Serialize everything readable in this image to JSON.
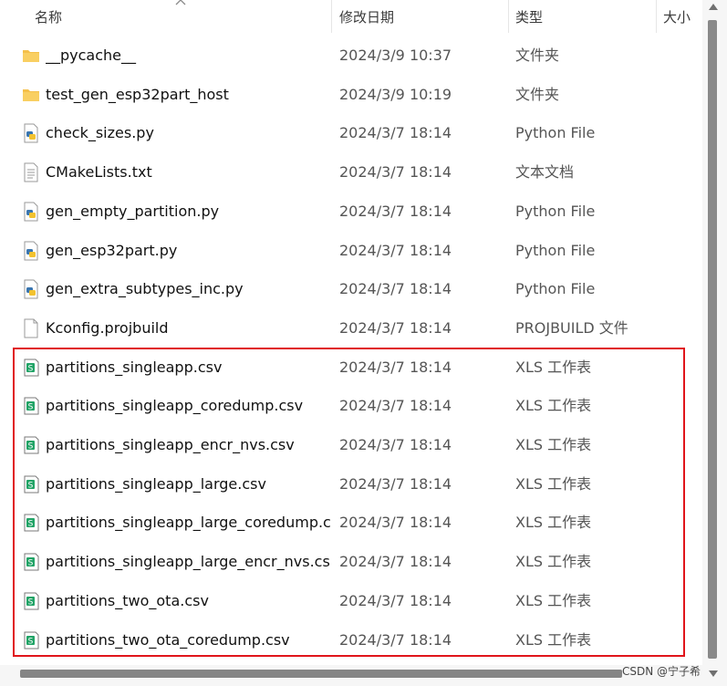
{
  "columns": {
    "name": "名称",
    "modified": "修改日期",
    "type": "类型",
    "size": "大小"
  },
  "files": [
    {
      "icon": "folder-icon",
      "name": "__pycache__",
      "modified": "2024/3/9 10:37",
      "type": "文件夹"
    },
    {
      "icon": "folder-icon",
      "name": "test_gen_esp32part_host",
      "modified": "2024/3/9 10:19",
      "type": "文件夹"
    },
    {
      "icon": "python-file-icon",
      "name": "check_sizes.py",
      "modified": "2024/3/7 18:14",
      "type": "Python File"
    },
    {
      "icon": "text-file-icon",
      "name": "CMakeLists.txt",
      "modified": "2024/3/7 18:14",
      "type": "文本文档"
    },
    {
      "icon": "python-file-icon",
      "name": "gen_empty_partition.py",
      "modified": "2024/3/7 18:14",
      "type": "Python File"
    },
    {
      "icon": "python-file-icon",
      "name": "gen_esp32part.py",
      "modified": "2024/3/7 18:14",
      "type": "Python File"
    },
    {
      "icon": "python-file-icon",
      "name": "gen_extra_subtypes_inc.py",
      "modified": "2024/3/7 18:14",
      "type": "Python File"
    },
    {
      "icon": "blank-file-icon",
      "name": "Kconfig.projbuild",
      "modified": "2024/3/7 18:14",
      "type": "PROJBUILD 文件"
    },
    {
      "icon": "spreadsheet-file-icon",
      "name": "partitions_singleapp.csv",
      "modified": "2024/3/7 18:14",
      "type": "XLS 工作表"
    },
    {
      "icon": "spreadsheet-file-icon",
      "name": "partitions_singleapp_coredump.csv",
      "modified": "2024/3/7 18:14",
      "type": "XLS 工作表"
    },
    {
      "icon": "spreadsheet-file-icon",
      "name": "partitions_singleapp_encr_nvs.csv",
      "modified": "2024/3/7 18:14",
      "type": "XLS 工作表"
    },
    {
      "icon": "spreadsheet-file-icon",
      "name": "partitions_singleapp_large.csv",
      "modified": "2024/3/7 18:14",
      "type": "XLS 工作表"
    },
    {
      "icon": "spreadsheet-file-icon",
      "name": "partitions_singleapp_large_coredump.c...",
      "modified": "2024/3/7 18:14",
      "type": "XLS 工作表"
    },
    {
      "icon": "spreadsheet-file-icon",
      "name": "partitions_singleapp_large_encr_nvs.csv",
      "modified": "2024/3/7 18:14",
      "type": "XLS 工作表"
    },
    {
      "icon": "spreadsheet-file-icon",
      "name": "partitions_two_ota.csv",
      "modified": "2024/3/7 18:14",
      "type": "XLS 工作表"
    },
    {
      "icon": "spreadsheet-file-icon",
      "name": "partitions_two_ota_coredump.csv",
      "modified": "2024/3/7 18:14",
      "type": "XLS 工作表"
    }
  ],
  "watermark": "CSDN @宁子希",
  "colors": {
    "highlight": "#e0151b",
    "folder": "#f5c04a",
    "spreadsheet": "#21a366"
  }
}
